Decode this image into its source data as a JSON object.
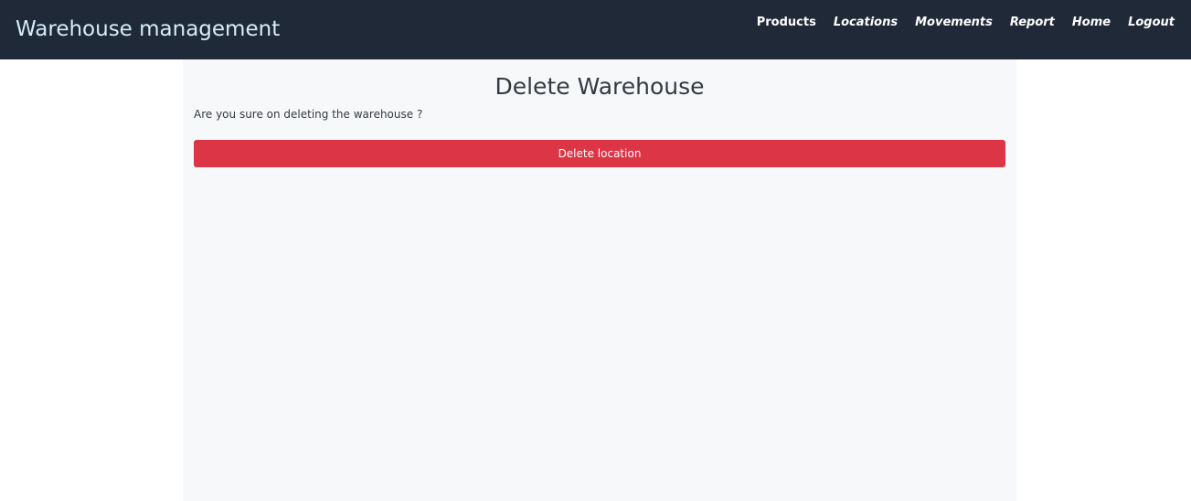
{
  "header": {
    "brand": "Warehouse management",
    "nav": [
      {
        "label": "Products"
      },
      {
        "label": "Locations"
      },
      {
        "label": "Movements"
      },
      {
        "label": "Report"
      },
      {
        "label": "Home"
      },
      {
        "label": "Logout"
      }
    ]
  },
  "main": {
    "title": "Delete Warehouse",
    "confirm_text": "Are you sure on deleting the warehouse ?",
    "delete_button_label": "Delete location"
  },
  "colors": {
    "navbar_bg": "#1f2937",
    "brand_text": "#d6ecf8",
    "panel_bg": "#f7f8fa",
    "danger": "#dc3545"
  }
}
